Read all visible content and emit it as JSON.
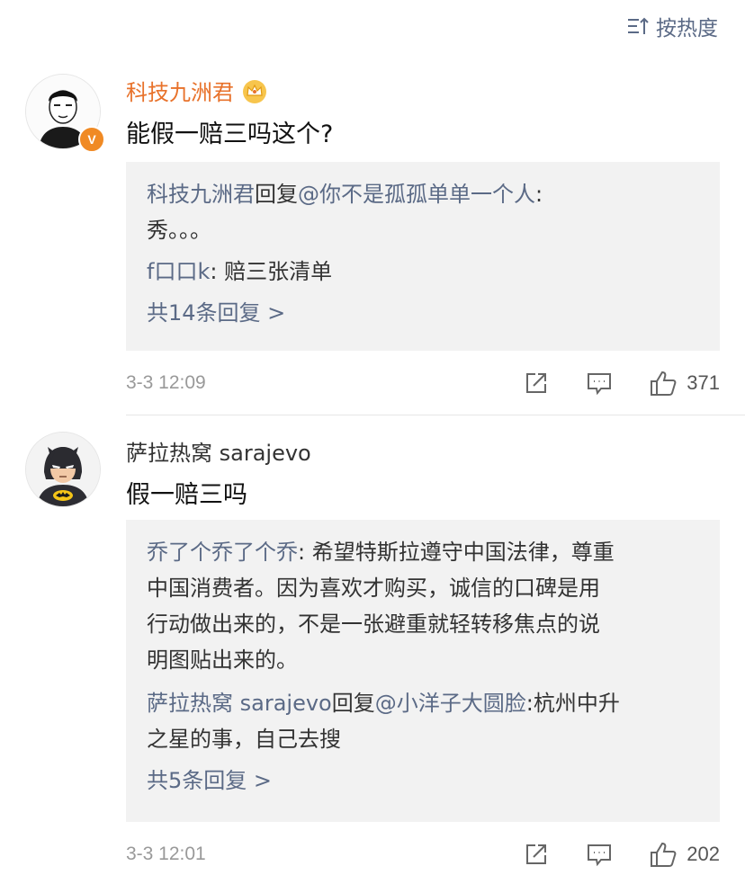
{
  "sort": {
    "label": "按热度"
  },
  "comments": [
    {
      "user": "科技九洲君",
      "verified_badge": "V",
      "text": "能假一赔三吗这个?",
      "replies": [
        {
          "who": "科技九洲君",
          "mid": "回复",
          "mention": "@你不是孤孤单单一个人",
          "rest": ":",
          "cont": "秀。。。"
        },
        {
          "who": "f口口k",
          "rest": ": 赔三张清单"
        }
      ],
      "more": "共14条回复 >",
      "time": "3-3 12:09",
      "likes": "371"
    },
    {
      "user": "萨拉热窝 sarajevo",
      "text": "假一赔三吗",
      "replies": [
        {
          "who": "乔了个乔了个乔",
          "rest": ": 希望特斯拉遵守中国法律，尊重",
          "cont": [
            "中国消费者。因为喜欢才购买，诚信的口碑是用",
            "行动做出来的，不是一张避重就轻转移焦点的说",
            "明图贴出来的。"
          ]
        },
        {
          "who": "萨拉热窝 sarajevo",
          "mid": "回复",
          "mention": "@小洋子大圆脸",
          "rest": ":杭州中升",
          "cont2": "之星的事，自己去搜"
        }
      ],
      "more": "共5条回复 >",
      "time": "3-3 12:01",
      "likes": "202"
    }
  ],
  "colors": {
    "link": "#5b6a86",
    "vip_name": "#e8722b",
    "badge": "#f08a24",
    "reply_bg": "#f2f2f2"
  }
}
